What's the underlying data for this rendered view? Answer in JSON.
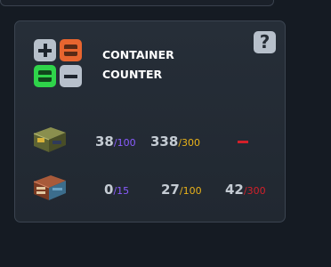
{
  "widget": {
    "title_line1": "CONTAINER",
    "title_line2": "COUNTER",
    "help_label": "?"
  },
  "rows": [
    {
      "name": "military crate",
      "c1": {
        "value": "38",
        "total": "/100"
      },
      "c2": {
        "value": "338",
        "total": "/300"
      },
      "c3": {
        "value": "–"
      }
    },
    {
      "name": "elite crate",
      "c1": {
        "value": "0",
        "total": "/15"
      },
      "c2": {
        "value": "27",
        "total": "/100"
      },
      "c3": {
        "value": "42",
        "total": "/300"
      }
    }
  ],
  "colors": {
    "purple": "#8a5cff",
    "gold": "#e9b21a",
    "red": "#d3202a",
    "green": "#2fd44a",
    "orange": "#e8652f"
  }
}
